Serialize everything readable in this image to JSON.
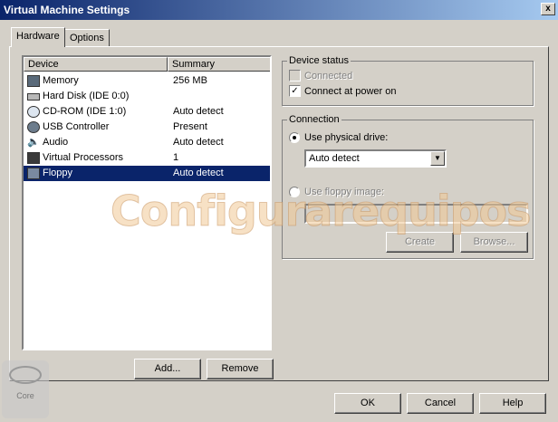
{
  "window": {
    "title": "Virtual Machine Settings",
    "close_glyph": "x"
  },
  "tabs": [
    {
      "label": "Hardware",
      "active": true
    },
    {
      "label": "Options",
      "active": false
    }
  ],
  "device_list": {
    "columns": {
      "device": "Device",
      "summary": "Summary"
    },
    "rows": [
      {
        "name": "Memory",
        "summary": "256 MB",
        "icon": "memory-icon"
      },
      {
        "name": "Hard Disk (IDE 0:0)",
        "summary": "",
        "icon": "hard-disk-icon"
      },
      {
        "name": "CD-ROM (IDE 1:0)",
        "summary": "Auto detect",
        "icon": "cdrom-icon"
      },
      {
        "name": "USB Controller",
        "summary": "Present",
        "icon": "usb-icon"
      },
      {
        "name": "Audio",
        "summary": "Auto detect",
        "icon": "audio-icon"
      },
      {
        "name": "Virtual Processors",
        "summary": "1",
        "icon": "processor-icon"
      },
      {
        "name": "Floppy",
        "summary": "Auto detect",
        "icon": "floppy-icon",
        "selected": true
      }
    ]
  },
  "list_buttons": {
    "add": "Add...",
    "remove": "Remove"
  },
  "device_status": {
    "title": "Device status",
    "connected": {
      "label": "Connected",
      "checked": false,
      "enabled": false
    },
    "connect_at_power_on": {
      "label": "Connect at power on",
      "checked": true,
      "enabled": true
    }
  },
  "connection": {
    "title": "Connection",
    "physical_drive": {
      "label": "Use physical drive:",
      "selected": true,
      "value": "Auto detect"
    },
    "floppy_image": {
      "label": "Use floppy image:",
      "selected": false,
      "value": ""
    },
    "create_label": "Create",
    "browse_label": "Browse..."
  },
  "dialog_buttons": {
    "ok": "OK",
    "cancel": "Cancel",
    "help": "Help"
  },
  "watermark": {
    "text": "Configurarequipos"
  },
  "logo": {
    "text": "Core"
  },
  "colors": {
    "titlebar": "#0a246a",
    "selection": "#0a246a",
    "face": "#d4d0c8"
  }
}
